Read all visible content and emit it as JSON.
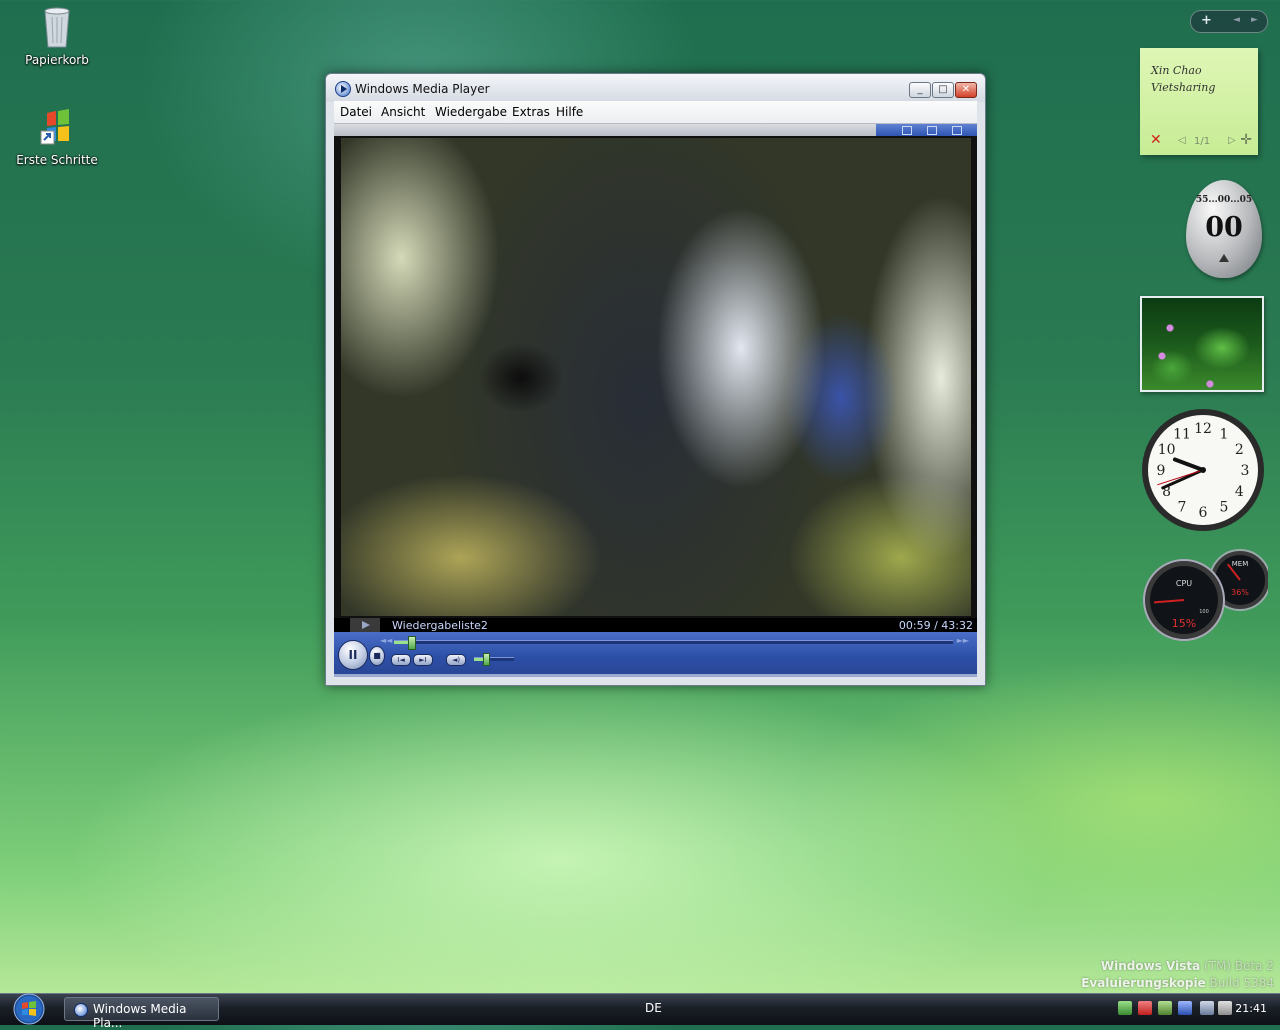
{
  "desktop": {
    "icons": [
      {
        "label": "Papierkorb",
        "icon": "recycle-bin-icon"
      },
      {
        "label": "Erste Schritte",
        "icon": "welcome-center-icon"
      }
    ]
  },
  "wmp": {
    "title": "Windows Media Player",
    "menu": [
      "Datei",
      "Ansicht",
      "Wiedergabe",
      "Extras",
      "Hilfe"
    ],
    "playlist": "Wiedergabeliste2",
    "time": "00:59 / 43:32",
    "seek_fraction": 0.03,
    "volume_fraction": 0.3,
    "caption_buttons": {
      "minimize": "minimize-icon",
      "maximize": "maximize-icon",
      "close": "close-icon"
    }
  },
  "sidebar": {
    "controls": {
      "add": "+",
      "prev": "◄",
      "next": "►"
    },
    "note": {
      "lines": [
        "Xin Chao",
        "Vietsharing"
      ],
      "page": "1/1"
    },
    "timer": {
      "dial": "55...00...05",
      "value": "00"
    },
    "clock": {
      "hour": 9,
      "minute": 41,
      "second": 42,
      "numbers": [
        "12",
        "1",
        "2",
        "3",
        "4",
        "5",
        "6",
        "7",
        "8",
        "9",
        "10",
        "11"
      ]
    },
    "meter": {
      "cpu_label": "CPU",
      "cpu_value": "15%",
      "cpu_fraction": 0.15,
      "mem_label": "MEM",
      "mem_value": "36%",
      "mem_fraction": 0.36,
      "scale_max": "100"
    }
  },
  "watermark": {
    "line1_bold": "Windows Vista",
    "line1_rest": " (TM) Beta 2",
    "line2_bold": "Evaluierungskopie",
    "line2_rest": " Build 5384"
  },
  "taskbar": {
    "task_label": "Windows Media Pla...",
    "language": "DE",
    "clock": "21:41"
  },
  "colors": {
    "accent": "#2c4fa6",
    "taskbar": "#1a1f27",
    "note": "#d3f1a5"
  }
}
